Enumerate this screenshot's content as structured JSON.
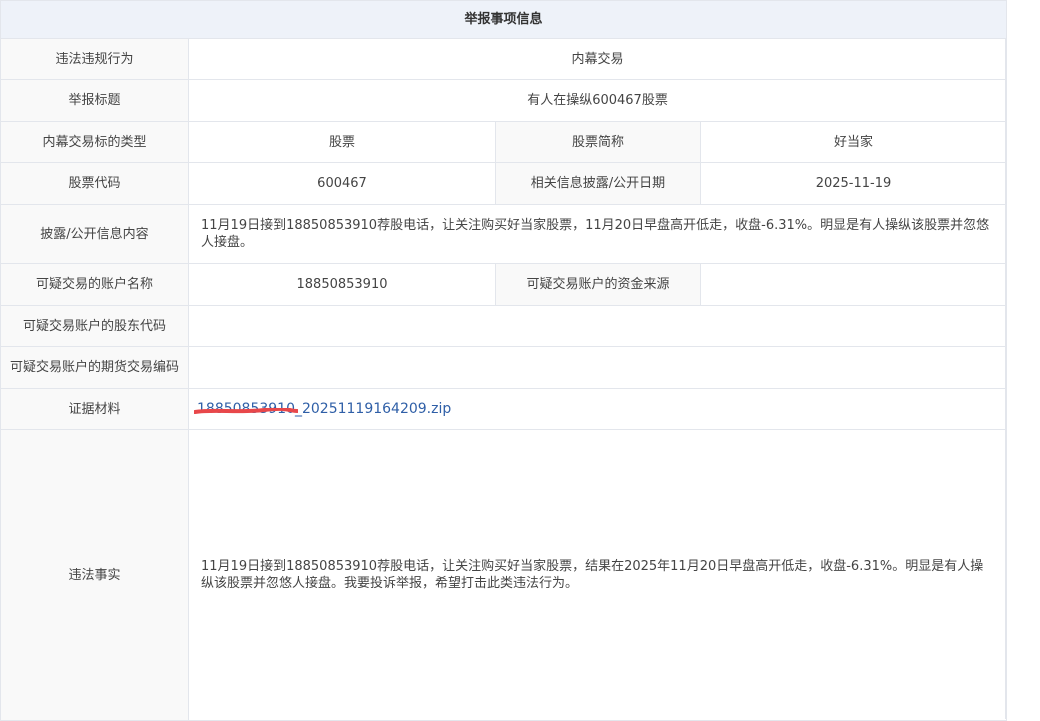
{
  "section": {
    "title": "举报事项信息"
  },
  "rows": {
    "violation": {
      "label": "违法违规行为",
      "value": "内幕交易"
    },
    "report_title": {
      "label": "举报标题",
      "value": "有人在操纵600467股票"
    },
    "target_type": {
      "label": "内幕交易标的类型",
      "value": "股票",
      "label2": "股票简称",
      "value2": "好当家"
    },
    "stock_code": {
      "label": "股票代码",
      "value": "600467",
      "label2": "相关信息披露/公开日期",
      "value2": "2025-11-19"
    },
    "disclosure": {
      "label": "披露/公开信息内容",
      "value": "11月19日接到18850853910荐股电话，让关注购买好当家股票，11月20日早盘高开低走，收盘-6.31%。明显是有人操纵该股票并忽悠人接盘。"
    },
    "account_name": {
      "label": "可疑交易的账户名称",
      "value": "18850853910",
      "label2": "可疑交易账户的资金来源",
      "value2": ""
    },
    "shareholder_code": {
      "label": "可疑交易账户的股东代码",
      "value": ""
    },
    "futures_code": {
      "label": "可疑交易账户的期货交易编码",
      "value": ""
    },
    "evidence": {
      "label": "证据材料",
      "file_name": "18850853910_20251119164209.zip"
    },
    "facts": {
      "label": "违法事实",
      "value": "11月19日接到18850853910荐股电话，让关注购买好当家股票，结果在2025年11月20日早盘高开低走，收盘-6.31%。明显是有人操纵该股票并忽悠人接盘。我要投诉举报，希望打击此类违法行为。"
    }
  },
  "colors": {
    "header_bg": "#eef2f9",
    "label_bg": "#f9f9f9",
    "border": "#e3e6ec",
    "link": "#2f5fa7",
    "redaction": "#e8474a"
  },
  "icons": {
    "redaction_mark": "red-scribble"
  }
}
